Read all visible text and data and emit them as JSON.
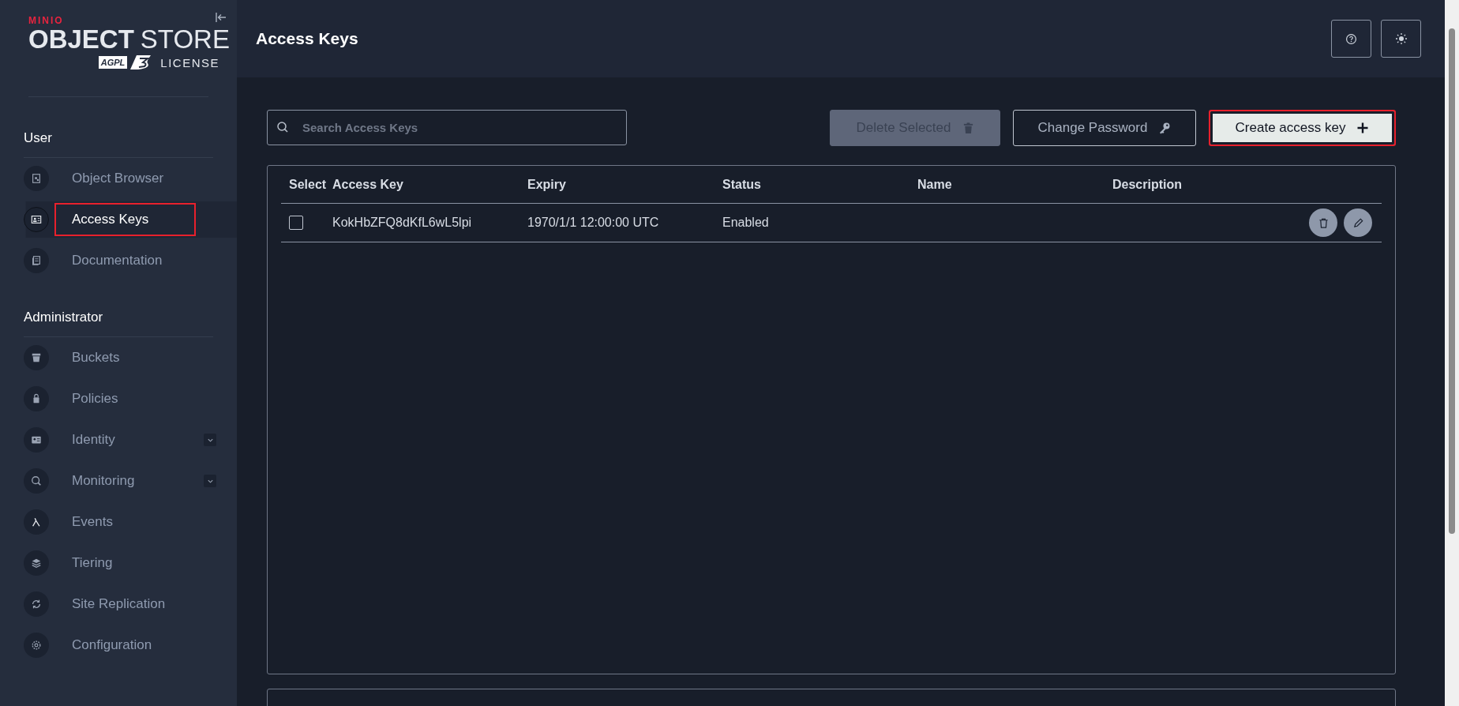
{
  "sidebar": {
    "logo": {
      "brand": "MINIO",
      "product_bold": "OBJECT",
      "product_light": "STORE",
      "license_badge": "AGPL",
      "license": "LICENSE"
    },
    "sections": [
      {
        "title": "User",
        "items": [
          {
            "label": "Object Browser",
            "selected": false,
            "highlighted": false,
            "has_submenu": false
          },
          {
            "label": "Access Keys",
            "selected": true,
            "highlighted": true,
            "has_submenu": false
          },
          {
            "label": "Documentation",
            "selected": false,
            "highlighted": false,
            "has_submenu": false
          }
        ]
      },
      {
        "title": "Administrator",
        "items": [
          {
            "label": "Buckets",
            "selected": false,
            "highlighted": false,
            "has_submenu": false
          },
          {
            "label": "Policies",
            "selected": false,
            "highlighted": false,
            "has_submenu": false
          },
          {
            "label": "Identity",
            "selected": false,
            "highlighted": false,
            "has_submenu": true
          },
          {
            "label": "Monitoring",
            "selected": false,
            "highlighted": false,
            "has_submenu": true
          },
          {
            "label": "Events",
            "selected": false,
            "highlighted": false,
            "has_submenu": false
          },
          {
            "label": "Tiering",
            "selected": false,
            "highlighted": false,
            "has_submenu": false
          },
          {
            "label": "Site Replication",
            "selected": false,
            "highlighted": false,
            "has_submenu": false
          },
          {
            "label": "Configuration",
            "selected": false,
            "highlighted": false,
            "has_submenu": false
          }
        ]
      }
    ]
  },
  "header": {
    "title": "Access Keys"
  },
  "toolbar": {
    "search": {
      "placeholder": "Search Access Keys"
    },
    "buttons": [
      {
        "label": "Delete Selected",
        "kind": "delete",
        "disabled": true,
        "highlighted": false
      },
      {
        "label": "Change Password",
        "kind": "password",
        "disabled": false,
        "highlighted": false
      },
      {
        "label": "Create access key",
        "kind": "create",
        "disabled": false,
        "highlighted": true
      }
    ]
  },
  "table": {
    "columns": [
      "Select",
      "Access Key",
      "Expiry",
      "Status",
      "Name",
      "Description"
    ],
    "rows": [
      {
        "checked": false,
        "access_key": "KokHbZFQ8dKfL6wL5lpi",
        "expiry": "1970/1/1 12:00:00 UTC",
        "status": "Enabled"
      }
    ]
  }
}
